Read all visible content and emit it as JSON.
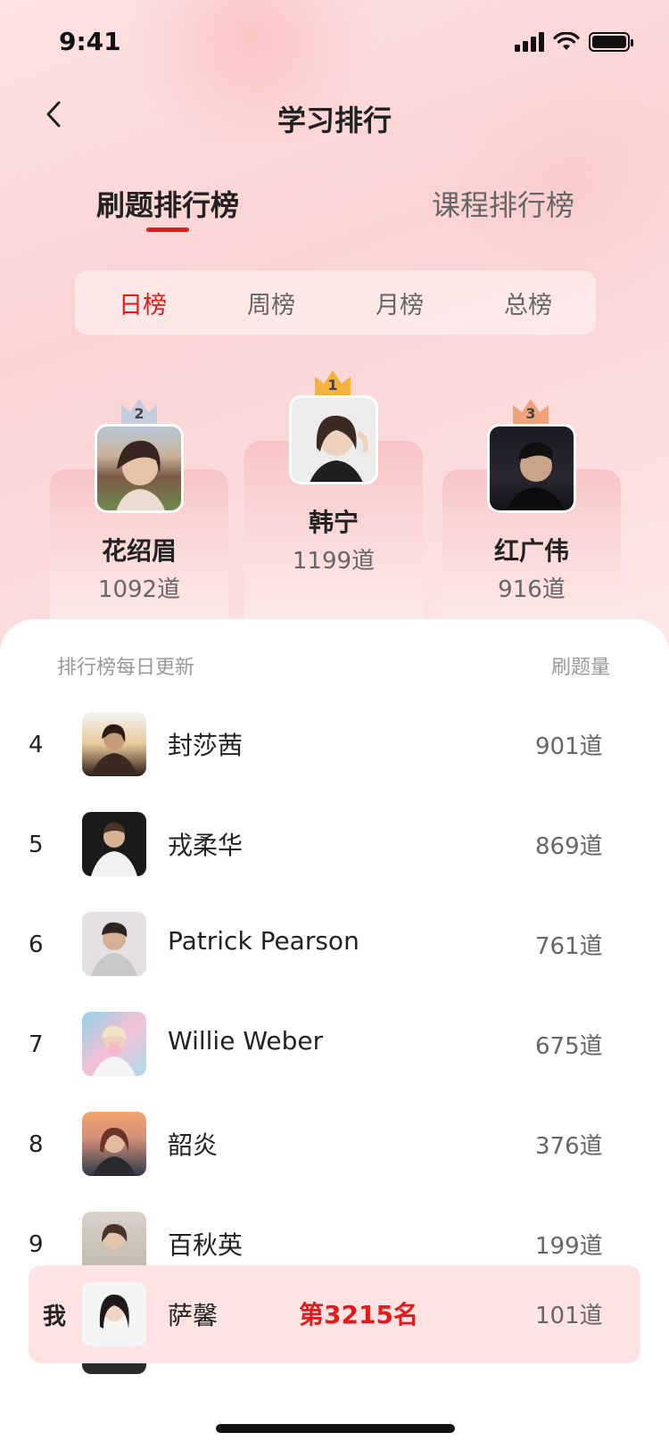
{
  "status_bar": {
    "time": "9:41"
  },
  "nav": {
    "title": "学习排行"
  },
  "main_tabs": [
    {
      "label": "刷题排行榜",
      "active": true
    },
    {
      "label": "课程排行榜",
      "active": false
    }
  ],
  "periods": [
    {
      "label": "日榜",
      "active": true
    },
    {
      "label": "周榜",
      "active": false
    },
    {
      "label": "月榜",
      "active": false
    },
    {
      "label": "总榜",
      "active": false
    }
  ],
  "podium": {
    "first": {
      "rank": "1",
      "name": "韩宁",
      "count": "1199道",
      "crown_color": "#f3b13e"
    },
    "second": {
      "rank": "2",
      "name": "花绍眉",
      "count": "1092道",
      "crown_color": "#b9c3d3"
    },
    "third": {
      "rank": "3",
      "name": "红广伟",
      "count": "916道",
      "crown_color": "#f0a27a"
    }
  },
  "list": {
    "header_left": "排行榜每日更新",
    "header_right": "刷题量",
    "rows": [
      {
        "rank": "4",
        "name": "封莎茜",
        "count": "901道"
      },
      {
        "rank": "5",
        "name": "戎柔华",
        "count": "869道"
      },
      {
        "rank": "6",
        "name": "Patrick Pearson",
        "count": "761道"
      },
      {
        "rank": "7",
        "name": "Willie Weber",
        "count": "675道"
      },
      {
        "rank": "8",
        "name": "韶炎",
        "count": "376道"
      },
      {
        "rank": "9",
        "name": "百秋英",
        "count": "199道"
      }
    ]
  },
  "me": {
    "label": "我",
    "name": "萨馨",
    "place": "第3215名",
    "count": "101道"
  },
  "colors": {
    "accent": "#e11b1b",
    "me_bg": "#fde3e3"
  }
}
